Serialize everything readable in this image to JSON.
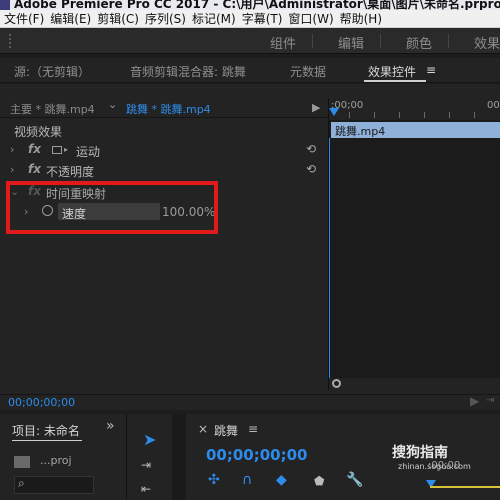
{
  "window": {
    "title_fragment": "Adobe Premiere Pro CC 2017 - C:\\用户\\Administrator\\桌面\\图片\\未命名.prproj"
  },
  "menu": [
    "文件(F)",
    "编辑(E)",
    "剪辑(C)",
    "序列(S)",
    "标记(M)",
    "字幕(T)",
    "窗口(W)",
    "帮助(H)"
  ],
  "workspaces": [
    "组件",
    "编辑",
    "颜色",
    "效果"
  ],
  "panel_tabs": {
    "source": "源:（无剪辑）",
    "audio_mixer": "音频剪辑混合器: 跳舞",
    "metadata": "元数据",
    "effect_controls": "效果控件",
    "menu_icon": "≡"
  },
  "clip_bar": {
    "master": "主要 * 跳舞.mp4",
    "chevron": "⌄",
    "sequence_clip": "跳舞 * 跳舞.mp4",
    "play_icon": "▶"
  },
  "effects": {
    "section_label": "视频效果",
    "motion": "运动",
    "opacity": "不透明度",
    "time_remap": "时间重映射",
    "speed_label": "速度",
    "speed_value": "100.00%",
    "fx": "fx",
    "reset_icon": "⟲"
  },
  "timeline": {
    "ruler_time_left": ":00;00",
    "ruler_time_right": "00",
    "clip_name": "跳舞.mp4"
  },
  "ec_timecode": "00;00;00;00",
  "project": {
    "title": "项目: 未命名",
    "expand": "»",
    "file": "...proj"
  },
  "sequence": {
    "close": "×",
    "name": "跳舞",
    "menu": "≡",
    "timecode": "00;00;00;00",
    "ruler_time": ":00;00"
  },
  "watermark": {
    "logo": "搜狗指南",
    "url": "zhinan.sogou.com"
  },
  "colors": {
    "accent_blue": "#2d8ceb",
    "highlight_red": "#e11b1b",
    "clip_blue": "#8fb0d8"
  }
}
